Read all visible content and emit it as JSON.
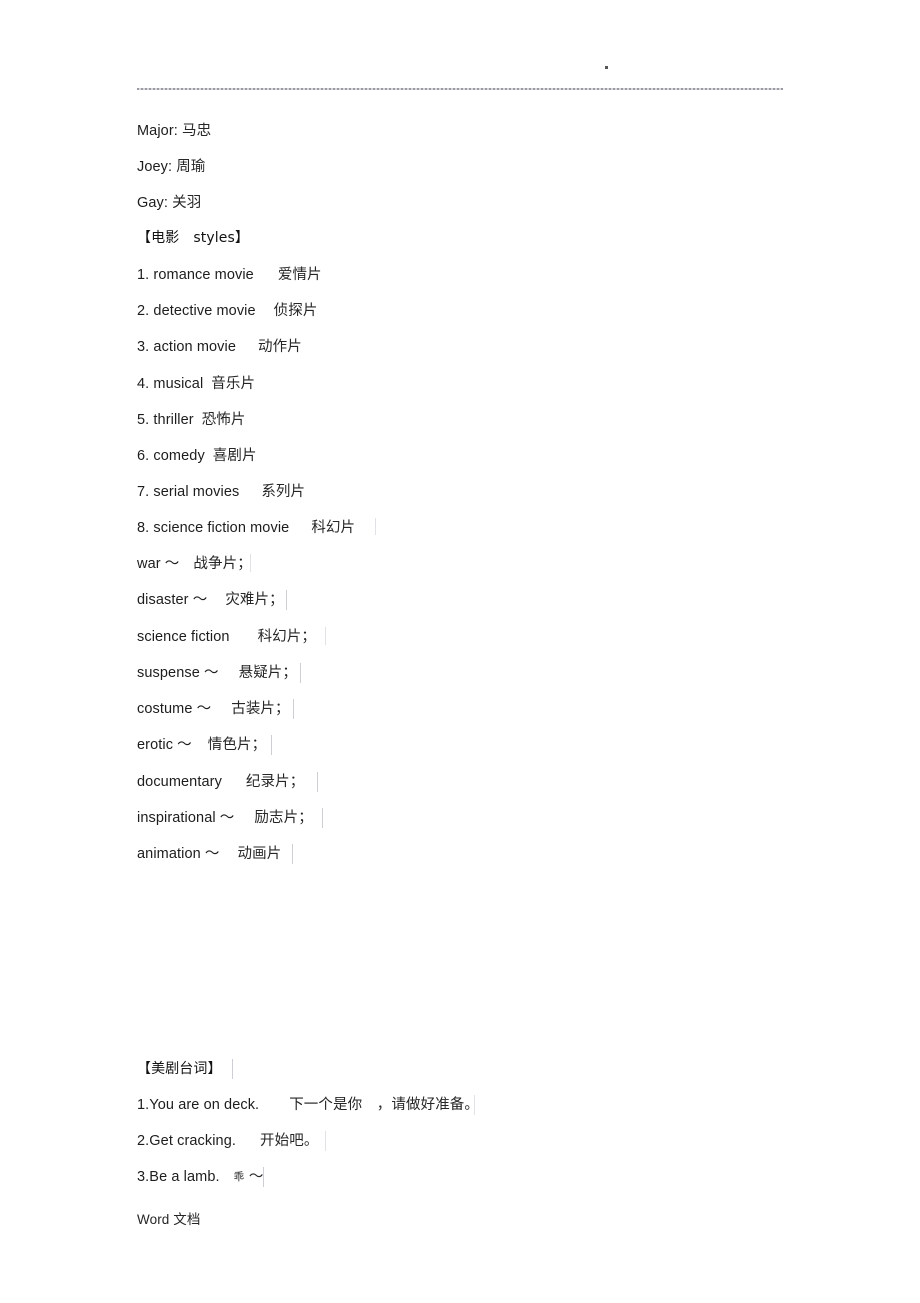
{
  "document": {
    "footer": "Word 文档"
  },
  "names": [
    {
      "en": "Major: ",
      "cn": "马忠"
    },
    {
      "en": "Joey: ",
      "cn": "周瑜"
    },
    {
      "en": "Gay: ",
      "cn": "关羽"
    }
  ],
  "movie_section": {
    "heading": "【电影　styles】",
    "items": [
      {
        "en": "1. romance movie",
        "cn": "爱情片"
      },
      {
        "en": "2. detective movie",
        "cn": "侦探片"
      },
      {
        "en": "3. action movie",
        "cn": "动作片"
      },
      {
        "en": "4. musical",
        "cn": "音乐片"
      },
      {
        "en": "5. thriller",
        "cn": "恐怖片"
      },
      {
        "en": "6. comedy",
        "cn": "喜剧片"
      },
      {
        "en": "7. serial movies",
        "cn": "系列片"
      },
      {
        "en": "8. science fiction movie",
        "cn": "科幻片"
      }
    ],
    "tilde_items": [
      {
        "en": "war ～",
        "cn": "战争片；"
      },
      {
        "en": "disaster ～",
        "cn": "灾难片；"
      },
      {
        "en": "science fiction",
        "cn": "科幻片；"
      },
      {
        "en": "suspense ～",
        "cn": "悬疑片；"
      },
      {
        "en": "costume ～",
        "cn": "古装片；"
      },
      {
        "en": "erotic ～",
        "cn": "情色片；"
      },
      {
        "en": "documentary",
        "cn": "纪录片；"
      },
      {
        "en": "inspirational ～",
        "cn": "励志片；"
      },
      {
        "en": "animation ～",
        "cn": "动画片"
      }
    ]
  },
  "tv_section": {
    "heading": "【美剧台词】",
    "lines": [
      {
        "en": "1.You are on deck.",
        "cn": "下一个是你　，请做好准备。"
      },
      {
        "en": "2.Get cracking.",
        "cn": "开始吧。"
      },
      {
        "en": "3.Be a lamb.",
        "cn": "乖",
        "cn_suffix": " ～"
      }
    ]
  }
}
